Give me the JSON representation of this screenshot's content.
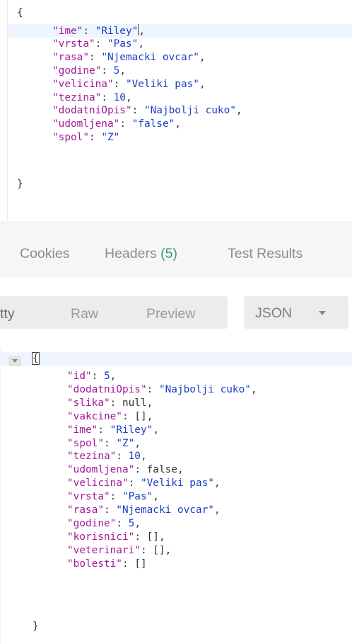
{
  "request_body": {
    "open_brace": "{",
    "close_brace": "}",
    "entries": [
      {
        "key": "\"ime\"",
        "value": "\"Riley\"",
        "value_type": "string",
        "comma": ","
      },
      {
        "key": "\"vrsta\"",
        "value": "\"Pas\"",
        "value_type": "string",
        "comma": ","
      },
      {
        "key": "\"rasa\"",
        "value": "\"Njemacki ovcar\"",
        "value_type": "string",
        "comma": ","
      },
      {
        "key": "\"godine\"",
        "value": "5",
        "value_type": "number",
        "comma": ","
      },
      {
        "key": "\"velicina\"",
        "value": "\"Veliki pas\"",
        "value_type": "string",
        "comma": ","
      },
      {
        "key": "\"tezina\"",
        "value": "10",
        "value_type": "number",
        "comma": ","
      },
      {
        "key": "\"dodatniOpis\"",
        "value": "\"Najbolji cuko\"",
        "value_type": "string",
        "comma": ","
      },
      {
        "key": "\"udomljena\"",
        "value": "\"false\"",
        "value_type": "string",
        "comma": ","
      },
      {
        "key": "\"spol\"",
        "value": "\"Z\"",
        "value_type": "string",
        "comma": ""
      }
    ]
  },
  "response_tabs": {
    "cookies": "Cookies",
    "headers": "Headers",
    "headers_count": "(5)",
    "test_results": "Test Results"
  },
  "format_bar": {
    "pretty": "tty",
    "raw": "Raw",
    "preview": "Preview",
    "format_select": "JSON"
  },
  "response_body": {
    "open_brace": "{",
    "close_brace": "}",
    "entries": [
      {
        "key": "\"id\"",
        "value": "5",
        "value_type": "number",
        "comma": ","
      },
      {
        "key": "\"dodatniOpis\"",
        "value": "\"Najbolji cuko\"",
        "value_type": "string",
        "comma": ","
      },
      {
        "key": "\"slika\"",
        "value": "null",
        "value_type": "literal",
        "comma": ","
      },
      {
        "key": "\"vakcine\"",
        "value": "[]",
        "value_type": "literal",
        "comma": ","
      },
      {
        "key": "\"ime\"",
        "value": "\"Riley\"",
        "value_type": "string",
        "comma": ","
      },
      {
        "key": "\"spol\"",
        "value": "\"Z\"",
        "value_type": "string",
        "comma": ","
      },
      {
        "key": "\"tezina\"",
        "value": "10",
        "value_type": "number",
        "comma": ","
      },
      {
        "key": "\"udomljena\"",
        "value": "false",
        "value_type": "literal",
        "comma": ","
      },
      {
        "key": "\"velicina\"",
        "value": "\"Veliki pas\"",
        "value_type": "string",
        "comma": ","
      },
      {
        "key": "\"vrsta\"",
        "value": "\"Pas\"",
        "value_type": "string",
        "comma": ","
      },
      {
        "key": "\"rasa\"",
        "value": "\"Njemacki ovcar\"",
        "value_type": "string",
        "comma": ","
      },
      {
        "key": "\"godine\"",
        "value": "5",
        "value_type": "number",
        "comma": ","
      },
      {
        "key": "\"korisnici\"",
        "value": "[]",
        "value_type": "literal",
        "comma": ","
      },
      {
        "key": "\"veterinari\"",
        "value": "[]",
        "value_type": "literal",
        "comma": ","
      },
      {
        "key": "\"bolesti\"",
        "value": "[]",
        "value_type": "literal",
        "comma": ""
      }
    ]
  },
  "colors": {
    "json_key": "#a11a9a",
    "json_string": "#1a3ec4",
    "json_literal": "#333333",
    "headers_count": "#3d9a6a",
    "active_line": "#eef5ff"
  }
}
